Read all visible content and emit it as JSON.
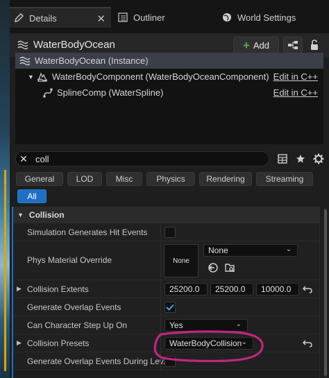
{
  "tabs": {
    "details": "Details",
    "outliner": "Outliner",
    "world_settings": "World Settings"
  },
  "header": {
    "title": "WaterBodyOcean",
    "add_label": "Add"
  },
  "tree": {
    "instance_label": "WaterBodyOcean (Instance)",
    "component_label": "WaterBodyComponent (WaterBodyOceanComponent)",
    "spline_label": "SplineComp (WaterSpline)",
    "edit_label": "Edit in C++"
  },
  "search": {
    "query": "coll"
  },
  "filters": [
    "General",
    "LOD",
    "Misc",
    "Physics",
    "Rendering",
    "Streaming",
    "All"
  ],
  "category": {
    "name": "Collision"
  },
  "properties": {
    "sim_hit_events": "Simulation Generates Hit Events",
    "phys_material": "Phys Material Override",
    "phys_material_thumb": "None",
    "phys_material_value": "None",
    "extents": "Collision Extents",
    "extent_x": "25200.0",
    "extent_y": "25200.0",
    "extent_z": "10000.0",
    "overlap_events": "Generate Overlap Events",
    "step_up": "Can Character Step Up On",
    "step_up_value": "Yes",
    "presets": "Collision Presets",
    "presets_value": "WaterBodyCollision",
    "overlap_level": "Generate Overlap Events During Lev..."
  },
  "colors": {
    "accent": "#1f6fc5",
    "checkmark": "#4d9ef0",
    "annotation": "#c0267f",
    "add_plus": "#4caf50"
  }
}
